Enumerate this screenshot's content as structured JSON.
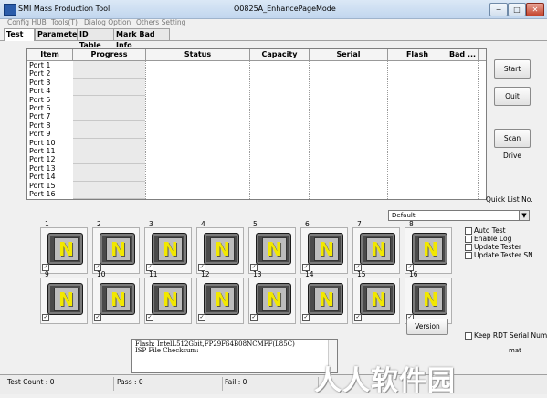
{
  "window": {
    "title": "SMI Mass Production Tool",
    "mode": "O0825A_EnhancePageMode",
    "controls": [
      "−",
      "□",
      "✕"
    ]
  },
  "menu": [
    "Config HUB",
    "Tools(T)",
    "Dialog Option",
    "Others Setting"
  ],
  "tabs": [
    "Test",
    "Parameter",
    "ID Table",
    "Mark Bad Info"
  ],
  "grid": {
    "columns": [
      "Item",
      "Progress",
      "Status",
      "Capacity",
      "Serial",
      "Flash",
      "Bad ..."
    ],
    "rows": [
      "Port 1",
      "Port 2",
      "Port 3",
      "Port 4",
      "Port 5",
      "Port 6",
      "Port 7",
      "Port 8",
      "Port 9",
      "Port 10",
      "Port 11",
      "Port 12",
      "Port 13",
      "Port 14",
      "Port 15",
      "Port 16"
    ]
  },
  "buttons": {
    "start": "Start",
    "quit": "Quit",
    "scan": "Scan Drive",
    "version": "Version"
  },
  "quick_list": {
    "label": "Quick List No.",
    "value": "Default"
  },
  "ports": {
    "row1": [
      {
        "num": "1",
        "glyph": "N"
      },
      {
        "num": "2",
        "glyph": "N"
      },
      {
        "num": "3",
        "glyph": "N"
      },
      {
        "num": "4",
        "glyph": "N"
      },
      {
        "num": "5",
        "glyph": "N"
      },
      {
        "num": "6",
        "glyph": "N"
      },
      {
        "num": "7",
        "glyph": "N"
      },
      {
        "num": "8",
        "glyph": "N"
      }
    ],
    "row2": [
      {
        "num": "9",
        "glyph": "N"
      },
      {
        "num": "10",
        "glyph": "N"
      },
      {
        "num": "11",
        "glyph": "N"
      },
      {
        "num": "12",
        "glyph": "N"
      },
      {
        "num": "13",
        "glyph": "N"
      },
      {
        "num": "14",
        "glyph": "N"
      },
      {
        "num": "15",
        "glyph": "N"
      },
      {
        "num": "16",
        "glyph": "N"
      }
    ],
    "checked": "✓"
  },
  "options": [
    "Auto Test",
    "Enable Log",
    "Update Tester",
    "Update Tester SN"
  ],
  "keep_rdt": "Keep RDT Serial Number",
  "rdt_tail": "mat",
  "info": {
    "line1": "Flash: IntelL512Gbit,FP29F64B08NCMFF(L85C)",
    "line2": "ISP File Checksum:"
  },
  "status": {
    "test_count": "Test Count : 0",
    "pass": "Pass : 0",
    "fail": "Fail : 0"
  },
  "watermark": "人人软件园"
}
